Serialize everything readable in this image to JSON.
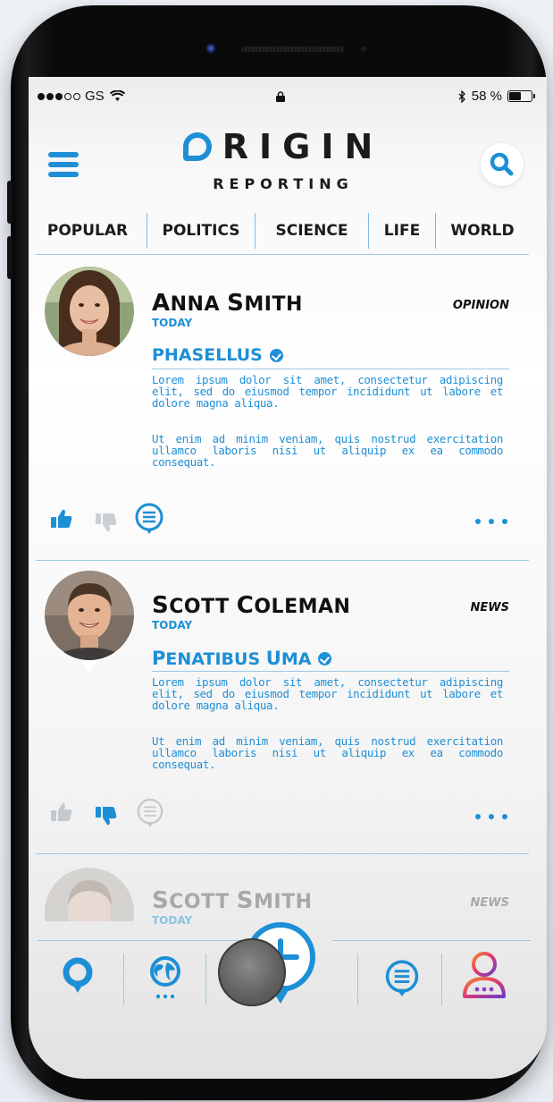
{
  "status_bar": {
    "carrier": "GS",
    "battery_text": "58 %",
    "battery_level": 0.58
  },
  "header": {
    "logo_main": "RIGIN",
    "logo_first_letter": "O",
    "logo_sub": "REPORTING"
  },
  "tabs": [
    {
      "label": "POPULAR"
    },
    {
      "label": "POLITICS"
    },
    {
      "label": "SCIENCE"
    },
    {
      "label": "LIFE"
    },
    {
      "label": "WORLD"
    }
  ],
  "posts": [
    {
      "author": "Anna Smith",
      "author_first_cap": "A",
      "author_rest": "NNA ",
      "author_last_cap": "S",
      "author_last_rest": "MITH",
      "time": "TODAY",
      "category": "OPINION",
      "headline": "PHASELLUS",
      "paragraph1": "Lorem ipsum dolor sit amet, consectetur adipiscing elit, sed do eiusmod tempor incididunt ut labore et dolore magna aliqua.",
      "paragraph2": "Ut enim ad minim veniam, quis nostrud exercitation ullamco laboris nisi ut aliquip ex ea commodo consequat."
    },
    {
      "author": "Scott Coleman",
      "author_first_cap": "S",
      "author_rest": "COTT ",
      "author_last_cap": "C",
      "author_last_rest": "OLEMAN",
      "time": "TODAY",
      "category": "NEWS",
      "headline_cap1": "P",
      "headline_rest1": "ENATIBUS ",
      "headline_cap2": "U",
      "headline_rest2": "MA",
      "paragraph1": "Lorem ipsum dolor sit amet, consectetur adipiscing elit, sed do eiusmod tempor incididunt ut labore et dolore magna aliqua.",
      "paragraph2": "Ut enim ad minim veniam, quis nostrud exercitation ullamco laboris nisi ut aliquip ex ea commodo consequat."
    },
    {
      "author": "Scott Smith",
      "author_first_cap": "S",
      "author_rest": "COTT ",
      "author_last_cap": "S",
      "author_last_rest": "MITH",
      "time": "TODAY",
      "category": "NEWS"
    }
  ],
  "colors": {
    "accent": "#1d8fd6",
    "text_dark": "#1b1b1b",
    "divider": "#9cc8e6"
  },
  "icons": {
    "menu": "hamburger-icon",
    "search": "search-icon",
    "like": "thumbs-up-icon",
    "dislike": "thumbs-down-icon",
    "comment": "comment-icon",
    "more": "more-icon",
    "location": "location-pin-icon",
    "globe": "globe-icon",
    "compose": "plus-icon",
    "messages": "chat-icon",
    "profile": "profile-icon"
  }
}
